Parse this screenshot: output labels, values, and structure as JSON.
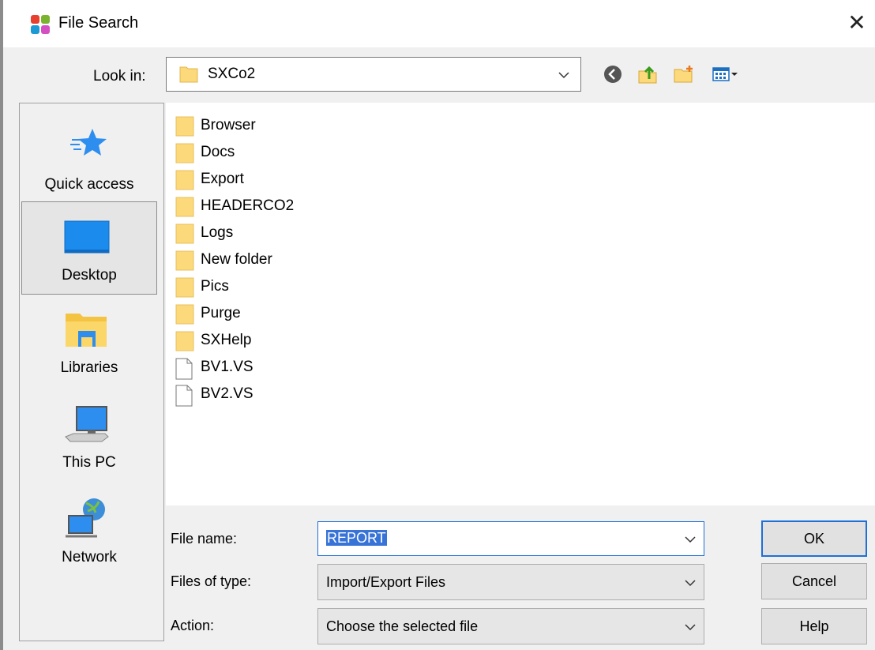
{
  "window": {
    "title": "File Search",
    "close_glyph": "✕"
  },
  "lookin": {
    "label": "Look in:",
    "value": "SXCo2"
  },
  "toolbar": {
    "icons": [
      "back-arrow-icon",
      "up-folder-icon",
      "new-folder-icon",
      "view-menu-icon"
    ]
  },
  "places": [
    {
      "label": "Quick access",
      "icon": "quick-access-star-icon"
    },
    {
      "label": "Desktop",
      "icon": "desktop-icon",
      "selected": true
    },
    {
      "label": "Libraries",
      "icon": "libraries-icon"
    },
    {
      "label": "This PC",
      "icon": "this-pc-icon"
    },
    {
      "label": "Network",
      "icon": "network-icon"
    }
  ],
  "files": [
    {
      "name": "Browser",
      "type": "folder"
    },
    {
      "name": "Docs",
      "type": "folder"
    },
    {
      "name": "Export",
      "type": "folder"
    },
    {
      "name": "HEADERCO2",
      "type": "folder"
    },
    {
      "name": "Logs",
      "type": "folder"
    },
    {
      "name": "New folder",
      "type": "folder"
    },
    {
      "name": "Pics",
      "type": "folder"
    },
    {
      "name": "Purge",
      "type": "folder"
    },
    {
      "name": "SXHelp",
      "type": "folder"
    },
    {
      "name": "BV1.VS",
      "type": "file"
    },
    {
      "name": "BV2.VS",
      "type": "file"
    }
  ],
  "form": {
    "filename_label": "File name:",
    "filename_value": "REPORT",
    "filetype_label": "Files of type:",
    "filetype_value": "Import/Export Files",
    "action_label": "Action:",
    "action_value": "Choose the selected file"
  },
  "buttons": {
    "ok": "OK",
    "cancel": "Cancel",
    "help": "Help"
  },
  "colors": {
    "accent": "#1e6fd8",
    "selection": "#3873d8",
    "folder": "#fcd97a"
  }
}
